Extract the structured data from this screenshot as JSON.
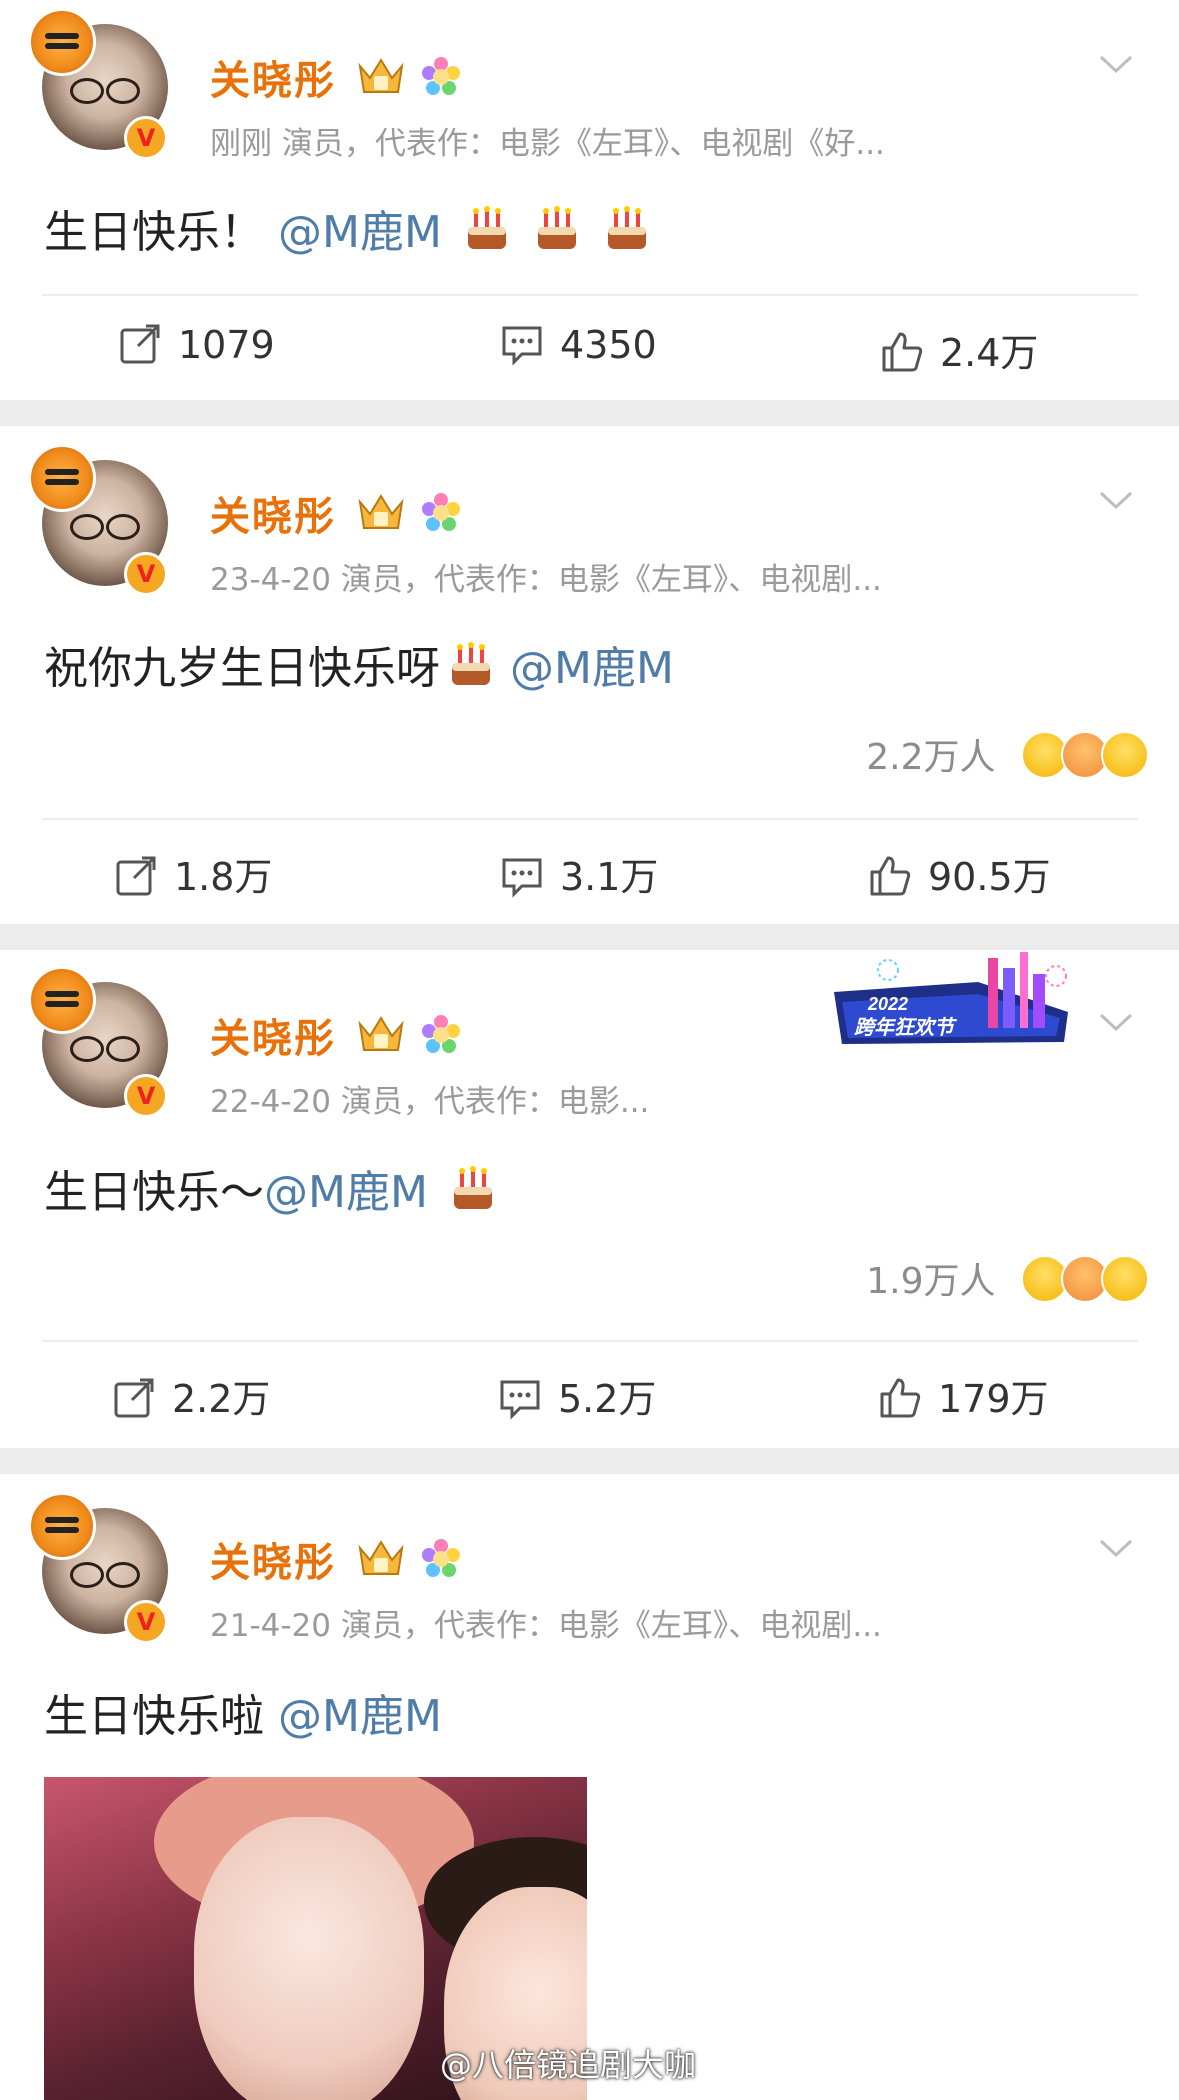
{
  "posts": [
    {
      "name": "关晓彤",
      "meta": "刚刚  演员，代表作：电影《左耳》、电视剧《好...",
      "text": "生日快乐！",
      "mention": "@M鹿M",
      "reactions": "",
      "repost": "1079",
      "comment": "4350",
      "like": "2.4万"
    },
    {
      "name": "关晓彤",
      "meta": "23-4-20  演员，代表作：电影《左耳》、电视剧...",
      "text": "祝你九岁生日快乐呀",
      "mention": "@M鹿M",
      "reactions": "2.2万人",
      "repost": "1.8万",
      "comment": "3.1万",
      "like": "90.5万"
    },
    {
      "name": "关晓彤",
      "meta": "22-4-20  演员，代表作：电影...",
      "text": "生日快乐～",
      "mention": "@M鹿M",
      "reactions": "1.9万人",
      "repost": "2.2万",
      "comment": "5.2万",
      "like": "179万"
    },
    {
      "name": "关晓彤",
      "meta": "21-4-20  演员，代表作：电影《左耳》、电视剧...",
      "text": "生日快乐啦",
      "mention": "@M鹿M"
    }
  ],
  "banner": {
    "year": "2022",
    "label": "跨年狂欢节"
  },
  "watermark": "@八倍镜追剧大咖",
  "icons": {
    "verified": "verified-v-badge",
    "crown": "crown-badge-icon",
    "flower": "flower-badge-icon",
    "cake": "cake-emoji",
    "repost": "repost-icon",
    "comment": "comment-icon",
    "like": "thumbs-up-icon",
    "menu": "chevron-down-icon"
  },
  "colors": {
    "name": "#e8710a",
    "mention": "#4f7ca8",
    "meta": "#9a9a9a",
    "separator": "#ececec"
  }
}
